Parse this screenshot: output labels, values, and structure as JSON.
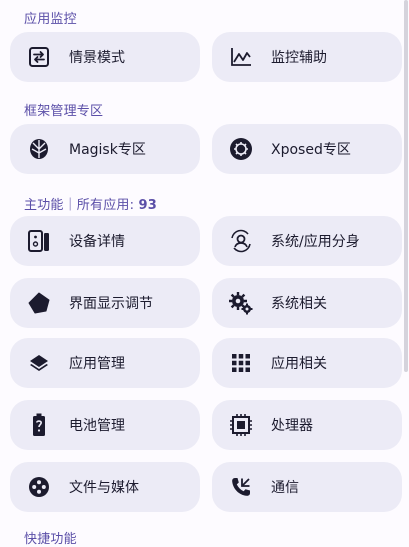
{
  "sections": {
    "monitor": "应用监控",
    "framework": "框架管理专区",
    "main_prefix": "主功能｜所有应用: ",
    "app_count": "93",
    "quick": "快捷功能"
  },
  "cards": {
    "scene_mode": "情景模式",
    "monitor_assist": "监控辅助",
    "magisk": "Magisk专区",
    "xposed": "Xposed专区",
    "device_details": "设备详情",
    "system_app_clone": "系统/应用分身",
    "display_tuning": "界面显示调节",
    "system_related": "系统相关",
    "app_management": "应用管理",
    "app_related": "应用相关",
    "battery_management": "电池管理",
    "processor": "处理器",
    "files_media": "文件与媒体",
    "communication": "通信"
  },
  "icons": {
    "scene_mode": "swap-box-icon",
    "monitor_assist": "line-chart-icon",
    "magisk": "magisk-icon",
    "xposed": "xposed-gear-icon",
    "device_details": "devices-icon",
    "system_app_clone": "account-sync-icon",
    "display_tuning": "brightness-tilt-icon",
    "system_related": "cogs-icon",
    "app_management": "layers-icon",
    "app_related": "apps-grid-icon",
    "battery_management": "battery-unknown-icon",
    "processor": "cpu-chip-icon",
    "files_media": "media-disc-icon",
    "communication": "phone-call-icon"
  },
  "colors": {
    "accent": "#5b4fa8",
    "card_bg": "#ecebf6",
    "page_bg": "#fdfbff",
    "text": "#1c1b2e"
  }
}
